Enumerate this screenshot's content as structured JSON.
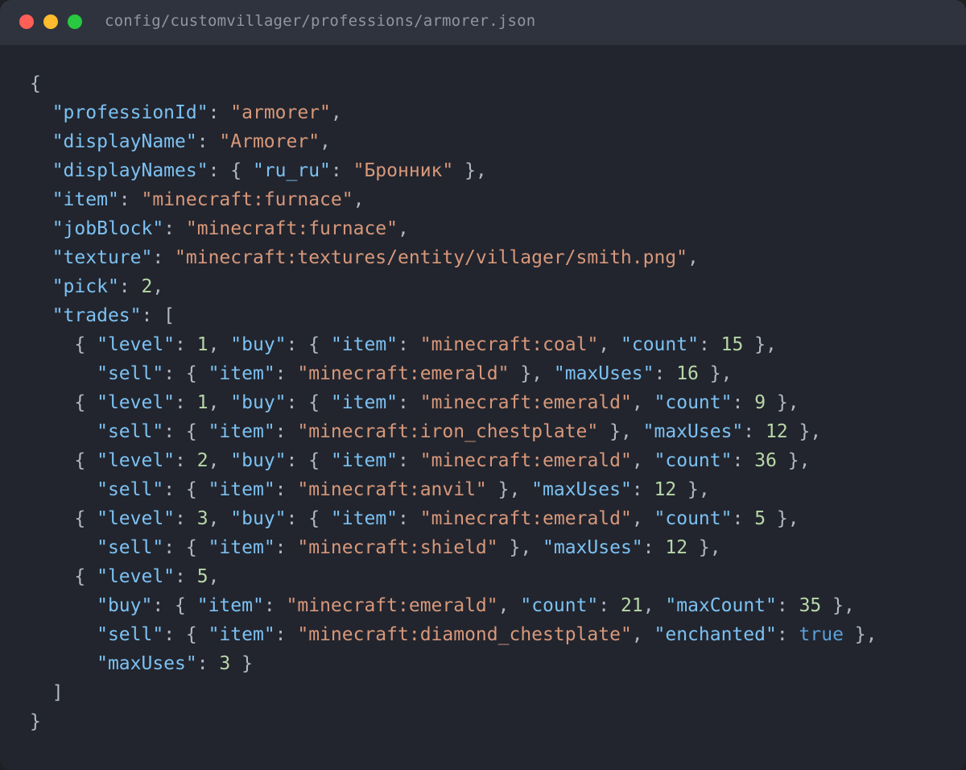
{
  "window": {
    "title": "config/customvillager/professions/armorer.json",
    "colors": {
      "background": "#22252e",
      "titlebar": "#2f333d",
      "key": "#7cc1f2",
      "string": "#d8987a",
      "number": "#b9d8a8",
      "boolean": "#5b9fd8",
      "punctuation": "#b2b8c4"
    }
  },
  "code_lines": [
    [
      [
        "p",
        "{"
      ]
    ],
    [
      [
        "p",
        "  "
      ],
      [
        "k",
        "\"professionId\""
      ],
      [
        "p",
        ": "
      ],
      [
        "s",
        "\"armorer\""
      ],
      [
        "p",
        ","
      ]
    ],
    [
      [
        "p",
        "  "
      ],
      [
        "k",
        "\"displayName\""
      ],
      [
        "p",
        ": "
      ],
      [
        "s",
        "\"Armorer\""
      ],
      [
        "p",
        ","
      ]
    ],
    [
      [
        "p",
        "  "
      ],
      [
        "k",
        "\"displayNames\""
      ],
      [
        "p",
        ": { "
      ],
      [
        "k",
        "\"ru_ru\""
      ],
      [
        "p",
        ": "
      ],
      [
        "s",
        "\"Бронник\""
      ],
      [
        "p",
        " },"
      ]
    ],
    [
      [
        "p",
        "  "
      ],
      [
        "k",
        "\"item\""
      ],
      [
        "p",
        ": "
      ],
      [
        "s",
        "\"minecraft:furnace\""
      ],
      [
        "p",
        ","
      ]
    ],
    [
      [
        "p",
        "  "
      ],
      [
        "k",
        "\"jobBlock\""
      ],
      [
        "p",
        ": "
      ],
      [
        "s",
        "\"minecraft:furnace\""
      ],
      [
        "p",
        ","
      ]
    ],
    [
      [
        "p",
        "  "
      ],
      [
        "k",
        "\"texture\""
      ],
      [
        "p",
        ": "
      ],
      [
        "s",
        "\"minecraft:textures/entity/villager/smith.png\""
      ],
      [
        "p",
        ","
      ]
    ],
    [
      [
        "p",
        "  "
      ],
      [
        "k",
        "\"pick\""
      ],
      [
        "p",
        ": "
      ],
      [
        "n",
        "2"
      ],
      [
        "p",
        ","
      ]
    ],
    [
      [
        "p",
        "  "
      ],
      [
        "k",
        "\"trades\""
      ],
      [
        "p",
        ": ["
      ]
    ],
    [
      [
        "p",
        "    { "
      ],
      [
        "k",
        "\"level\""
      ],
      [
        "p",
        ": "
      ],
      [
        "n",
        "1"
      ],
      [
        "p",
        ", "
      ],
      [
        "k",
        "\"buy\""
      ],
      [
        "p",
        ": { "
      ],
      [
        "k",
        "\"item\""
      ],
      [
        "p",
        ": "
      ],
      [
        "s",
        "\"minecraft:coal\""
      ],
      [
        "p",
        ", "
      ],
      [
        "k",
        "\"count\""
      ],
      [
        "p",
        ": "
      ],
      [
        "n",
        "15"
      ],
      [
        "p",
        " },"
      ]
    ],
    [
      [
        "p",
        "      "
      ],
      [
        "k",
        "\"sell\""
      ],
      [
        "p",
        ": { "
      ],
      [
        "k",
        "\"item\""
      ],
      [
        "p",
        ": "
      ],
      [
        "s",
        "\"minecraft:emerald\""
      ],
      [
        "p",
        " }, "
      ],
      [
        "k",
        "\"maxUses\""
      ],
      [
        "p",
        ": "
      ],
      [
        "n",
        "16"
      ],
      [
        "p",
        " },"
      ]
    ],
    [
      [
        "p",
        "    { "
      ],
      [
        "k",
        "\"level\""
      ],
      [
        "p",
        ": "
      ],
      [
        "n",
        "1"
      ],
      [
        "p",
        ", "
      ],
      [
        "k",
        "\"buy\""
      ],
      [
        "p",
        ": { "
      ],
      [
        "k",
        "\"item\""
      ],
      [
        "p",
        ": "
      ],
      [
        "s",
        "\"minecraft:emerald\""
      ],
      [
        "p",
        ", "
      ],
      [
        "k",
        "\"count\""
      ],
      [
        "p",
        ": "
      ],
      [
        "n",
        "9"
      ],
      [
        "p",
        " },"
      ]
    ],
    [
      [
        "p",
        "      "
      ],
      [
        "k",
        "\"sell\""
      ],
      [
        "p",
        ": { "
      ],
      [
        "k",
        "\"item\""
      ],
      [
        "p",
        ": "
      ],
      [
        "s",
        "\"minecraft:iron_chestplate\""
      ],
      [
        "p",
        " }, "
      ],
      [
        "k",
        "\"maxUses\""
      ],
      [
        "p",
        ": "
      ],
      [
        "n",
        "12"
      ],
      [
        "p",
        " },"
      ]
    ],
    [
      [
        "p",
        "    { "
      ],
      [
        "k",
        "\"level\""
      ],
      [
        "p",
        ": "
      ],
      [
        "n",
        "2"
      ],
      [
        "p",
        ", "
      ],
      [
        "k",
        "\"buy\""
      ],
      [
        "p",
        ": { "
      ],
      [
        "k",
        "\"item\""
      ],
      [
        "p",
        ": "
      ],
      [
        "s",
        "\"minecraft:emerald\""
      ],
      [
        "p",
        ", "
      ],
      [
        "k",
        "\"count\""
      ],
      [
        "p",
        ": "
      ],
      [
        "n",
        "36"
      ],
      [
        "p",
        " },"
      ]
    ],
    [
      [
        "p",
        "      "
      ],
      [
        "k",
        "\"sell\""
      ],
      [
        "p",
        ": { "
      ],
      [
        "k",
        "\"item\""
      ],
      [
        "p",
        ": "
      ],
      [
        "s",
        "\"minecraft:anvil\""
      ],
      [
        "p",
        " }, "
      ],
      [
        "k",
        "\"maxUses\""
      ],
      [
        "p",
        ": "
      ],
      [
        "n",
        "12"
      ],
      [
        "p",
        " },"
      ]
    ],
    [
      [
        "p",
        "    { "
      ],
      [
        "k",
        "\"level\""
      ],
      [
        "p",
        ": "
      ],
      [
        "n",
        "3"
      ],
      [
        "p",
        ", "
      ],
      [
        "k",
        "\"buy\""
      ],
      [
        "p",
        ": { "
      ],
      [
        "k",
        "\"item\""
      ],
      [
        "p",
        ": "
      ],
      [
        "s",
        "\"minecraft:emerald\""
      ],
      [
        "p",
        ", "
      ],
      [
        "k",
        "\"count\""
      ],
      [
        "p",
        ": "
      ],
      [
        "n",
        "5"
      ],
      [
        "p",
        " },"
      ]
    ],
    [
      [
        "p",
        "      "
      ],
      [
        "k",
        "\"sell\""
      ],
      [
        "p",
        ": { "
      ],
      [
        "k",
        "\"item\""
      ],
      [
        "p",
        ": "
      ],
      [
        "s",
        "\"minecraft:shield\""
      ],
      [
        "p",
        " }, "
      ],
      [
        "k",
        "\"maxUses\""
      ],
      [
        "p",
        ": "
      ],
      [
        "n",
        "12"
      ],
      [
        "p",
        " },"
      ]
    ],
    [
      [
        "p",
        "    { "
      ],
      [
        "k",
        "\"level\""
      ],
      [
        "p",
        ": "
      ],
      [
        "n",
        "5"
      ],
      [
        "p",
        ","
      ]
    ],
    [
      [
        "p",
        "      "
      ],
      [
        "k",
        "\"buy\""
      ],
      [
        "p",
        ": { "
      ],
      [
        "k",
        "\"item\""
      ],
      [
        "p",
        ": "
      ],
      [
        "s",
        "\"minecraft:emerald\""
      ],
      [
        "p",
        ", "
      ],
      [
        "k",
        "\"count\""
      ],
      [
        "p",
        ": "
      ],
      [
        "n",
        "21"
      ],
      [
        "p",
        ", "
      ],
      [
        "k",
        "\"maxCount\""
      ],
      [
        "p",
        ": "
      ],
      [
        "n",
        "35"
      ],
      [
        "p",
        " },"
      ]
    ],
    [
      [
        "p",
        "      "
      ],
      [
        "k",
        "\"sell\""
      ],
      [
        "p",
        ": { "
      ],
      [
        "k",
        "\"item\""
      ],
      [
        "p",
        ": "
      ],
      [
        "s",
        "\"minecraft:diamond_chestplate\""
      ],
      [
        "p",
        ", "
      ],
      [
        "k",
        "\"enchanted\""
      ],
      [
        "p",
        ": "
      ],
      [
        "b",
        "true"
      ],
      [
        "p",
        " },"
      ]
    ],
    [
      [
        "p",
        "      "
      ],
      [
        "k",
        "\"maxUses\""
      ],
      [
        "p",
        ": "
      ],
      [
        "n",
        "3"
      ],
      [
        "p",
        " }"
      ]
    ],
    [
      [
        "p",
        "  ]"
      ]
    ],
    [
      [
        "p",
        "}"
      ]
    ]
  ]
}
